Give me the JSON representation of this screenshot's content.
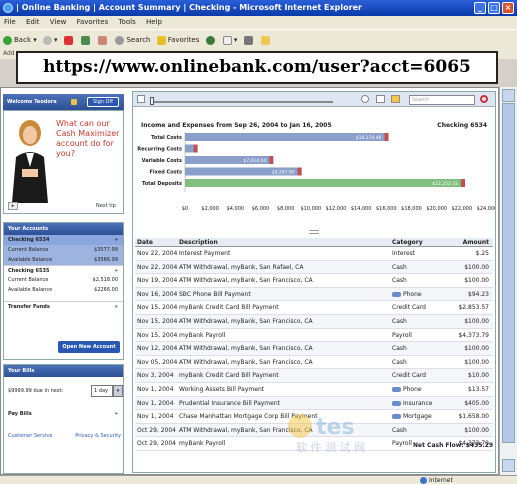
{
  "window": {
    "title": "| Online Banking | Account Summary | Checking - Microsoft Internet Explorer"
  },
  "menu": [
    "File",
    "Edit",
    "View",
    "Favorites",
    "Tools",
    "Help"
  ],
  "toolbar": {
    "back": "Back",
    "search": "Search",
    "favorites": "Favorites"
  },
  "address": {
    "label": "Add",
    "url": "https://www.onlinebank.com/user?acct=6065"
  },
  "left": {
    "welcome": "Welcome Teodora",
    "signoff": "Sign Off",
    "promo": "What can our Cash Maximizer account do for you?",
    "next_tip": "Next tip",
    "accounts_title": "Your Accounts",
    "accounts": [
      {
        "name": "Checking 6534",
        "current_label": "Current Balance",
        "current": "$3577.99",
        "available_label": "Available Balance",
        "available": "$3566.99"
      },
      {
        "name": "Checking 6535",
        "current_label": "Current Balance",
        "current": "$2,518.00",
        "available_label": "Available Balance",
        "available": "$2266.00"
      }
    ],
    "transfer": "Transfer Funds",
    "new_account": "Open New Account",
    "bills_title": "Your Bills",
    "bills_due": "$9999.99 due in next:",
    "bills_days": "1 day",
    "pay_bills": "Pay Bills",
    "customer_service": "Customer Service",
    "privacy": "Privacy & Security"
  },
  "right": {
    "search_placeholder": "Search",
    "chart_title": "Income and Expenses from Sep 26, 2004 to Jan 16, 2005",
    "account": "Checking 6534",
    "net_cash": "Net Cash Flow: $435.29"
  },
  "chart_data": {
    "type": "bar",
    "orientation": "horizontal",
    "categories": [
      "Total Costs",
      "Recurring Costs",
      "Variable Costs",
      "Fixed Costs",
      "Total Deposits"
    ],
    "values": [
      16174.46,
      1000,
      7014.64,
      9267.9,
      22252.33
    ],
    "data_labels": [
      "$16,174.46",
      "",
      "$7,014.64",
      "$9,267.90",
      "$22,252.33"
    ],
    "xlim": [
      0,
      24000
    ],
    "xticks": [
      "$0",
      "$2,000",
      "$4,000",
      "$6,000",
      "$8,000",
      "$10,000",
      "$12,000",
      "$14,000",
      "$16,000",
      "$18,000",
      "$20,000",
      "$22,000",
      "$24,000"
    ],
    "colors": {
      "costs": "#8a9fc9",
      "deposits": "#7fbf7f",
      "highlight": "#c0504d"
    }
  },
  "table": {
    "headers": [
      "Date",
      "Description",
      "Category",
      "Amount"
    ],
    "rows": [
      [
        "Nov 22, 2004",
        "Interest Payment",
        "Interest",
        "$.25"
      ],
      [
        "Nov 22, 2004",
        "ATM Withdrawal, myBank, San Rafael, CA",
        "Cash",
        "$100.00"
      ],
      [
        "Nov 19, 2004",
        "ATM Withdrawal, myBank, San Francisco, CA",
        "Cash",
        "$100.00"
      ],
      [
        "Nov 16, 2004",
        "SBC Phone Bill Payment",
        "Phone",
        "$94.23"
      ],
      [
        "Nov 15, 2004",
        "myBank Credit Card Bill Payment",
        "Credit Card",
        "$2,853.57"
      ],
      [
        "Nov 15, 2004",
        "ATM Withdrawal, myBank, San Francisco, CA",
        "Cash",
        "$100.00"
      ],
      [
        "Nov 15, 2004",
        "myBank Payroll",
        "Payroll",
        "$4,373.79"
      ],
      [
        "Nov 12, 2004",
        "ATM Withdrawal, myBank, San Francisco, CA",
        "Cash",
        "$100.00"
      ],
      [
        "Nov 05, 2004",
        "ATM Withdrawal, myBank, San Francisco, CA",
        "Cash",
        "$100.00"
      ],
      [
        "Nov 3, 2004",
        "myBank Credit Card Bill Payment",
        "Credit Card",
        "$10.00"
      ],
      [
        "Nov 1, 2004",
        "Working Assets Bill Payment",
        "Phone",
        "$13.57"
      ],
      [
        "Nov 1, 2004",
        "Prudential Insurance Bill Payment",
        "Insurance",
        "$405.00"
      ],
      [
        "Nov 1, 2004",
        "Chase Manhattan Mortgage Corp Bill Payment",
        "Mortgage",
        "$1,658.00"
      ],
      [
        "Oct 29, 2004",
        "ATM Withdrawal, myBank, San Francisco, CA",
        "Cash",
        "$100.00"
      ],
      [
        "Oct 29, 2004",
        "myBank Payroll",
        "Payroll",
        "$4,373.79"
      ]
    ]
  },
  "status": {
    "zone": "Internet"
  },
  "watermark": {
    "brand": "tes",
    "subtitle": "软 件 测 试 网"
  }
}
